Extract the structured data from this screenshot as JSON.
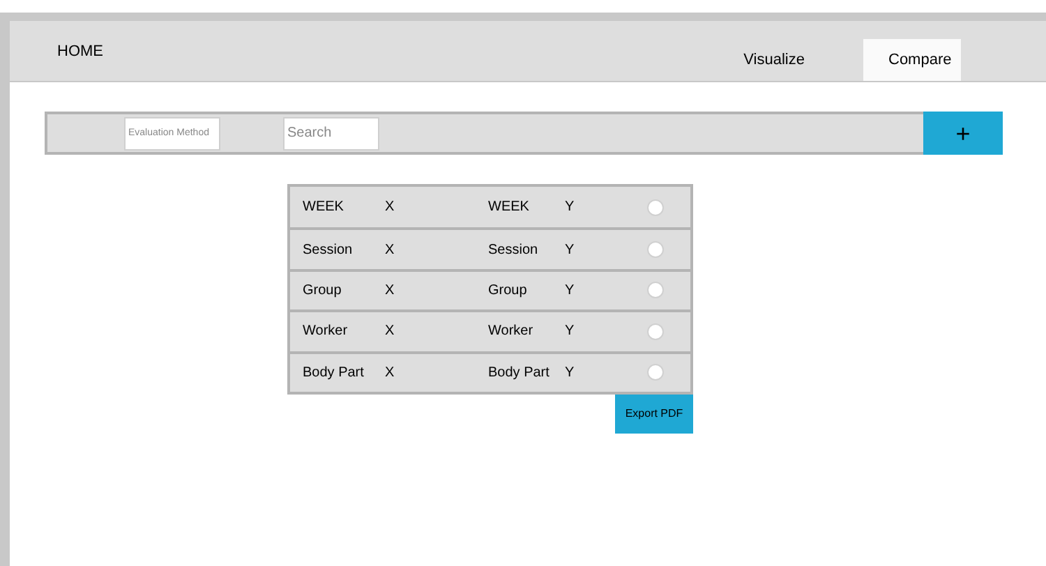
{
  "header": {
    "home": "HOME",
    "tabs": [
      {
        "label": "Visualize",
        "selected": false
      },
      {
        "label": "Compare",
        "selected": true
      }
    ]
  },
  "toolbar": {
    "evaluation_method": {
      "placeholder": "Evaluation Method"
    },
    "search": {
      "placeholder": "Search"
    },
    "add_button": "+"
  },
  "table": {
    "rows": [
      {
        "x_label": "WEEK",
        "x": "X",
        "y_label": "WEEK",
        "y": "Y",
        "selected": false
      },
      {
        "x_label": "Session",
        "x": "X",
        "y_label": "Session",
        "y": "Y",
        "selected": false
      },
      {
        "x_label": "Group",
        "x": "X",
        "y_label": "Group",
        "y": "Y",
        "selected": false
      },
      {
        "x_label": "Worker",
        "x": "X",
        "y_label": "Worker",
        "y": "Y",
        "selected": false
      },
      {
        "x_label": "Body Part",
        "x": "X",
        "y_label": "Body Part",
        "y": "Y",
        "selected": false
      }
    ]
  },
  "export_button": "Export PDF"
}
